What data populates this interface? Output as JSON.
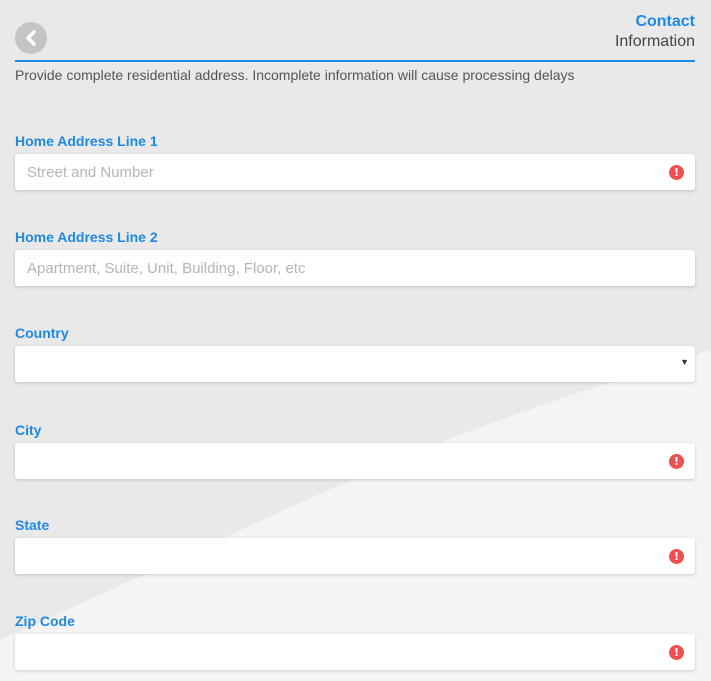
{
  "header": {
    "title_main": "Contact",
    "title_sub": "Information",
    "back_icon": "chevron-left-icon"
  },
  "instructions": "Provide complete residential address. Incomplete information will cause processing delays",
  "fields": {
    "address1": {
      "label": "Home Address Line 1",
      "placeholder": "Street and Number",
      "value": "",
      "error": true
    },
    "address2": {
      "label": "Home Address Line 2",
      "placeholder": "Apartment, Suite, Unit, Building, Floor, etc",
      "value": "",
      "error": false
    },
    "country": {
      "label": "Country",
      "value": "",
      "type": "select"
    },
    "city": {
      "label": "City",
      "value": "",
      "error": true
    },
    "state": {
      "label": "State",
      "value": "",
      "error": true
    },
    "zip": {
      "label": "Zip Code",
      "value": "",
      "error": true
    }
  },
  "icons": {
    "error": "!",
    "caret": "▼"
  },
  "colors": {
    "accent": "#1e88e5",
    "error": "#ef4f4f",
    "background": "#e9e9e9"
  }
}
